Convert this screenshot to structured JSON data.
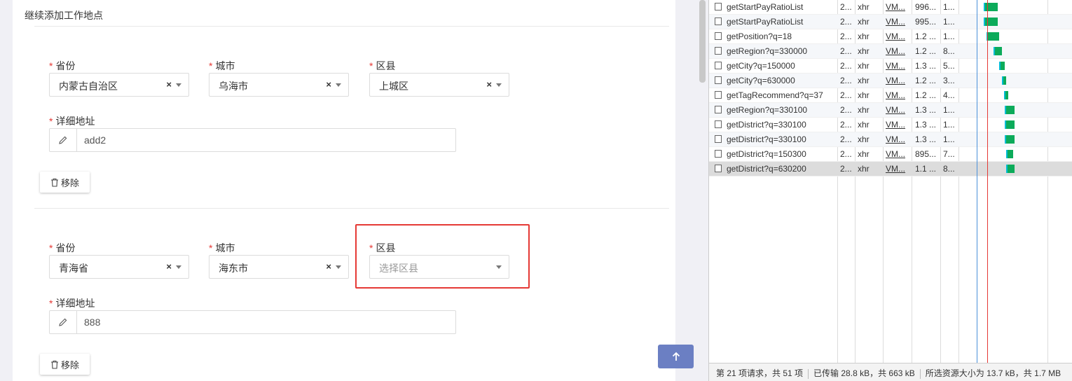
{
  "form": {
    "section_title": "继续添加工作地点",
    "entries": [
      {
        "province_label": "省份",
        "province_value": "内蒙古自治区",
        "city_label": "城市",
        "city_value": "乌海市",
        "district_label": "区县",
        "district_value": "上城区",
        "address_label": "详细地址",
        "address_value": "add2",
        "remove_label": "移除"
      },
      {
        "province_label": "省份",
        "province_value": "青海省",
        "city_label": "城市",
        "city_value": "海东市",
        "district_label": "区县",
        "district_placeholder": "选择区县",
        "address_label": "详细地址",
        "address_value": "888",
        "remove_label": "移除"
      }
    ],
    "required_mark": "*",
    "clear_mark": "×"
  },
  "network": {
    "rows": [
      {
        "name": "getStartPayRatioList",
        "status": "2...",
        "type": "xhr",
        "initiator": "VM...",
        "size": "996...",
        "time": "1..."
      },
      {
        "name": "getStartPayRatioList",
        "status": "2...",
        "type": "xhr",
        "initiator": "VM...",
        "size": "995...",
        "time": "1..."
      },
      {
        "name": "getPosition?q=18",
        "status": "2...",
        "type": "xhr",
        "initiator": "VM...",
        "size": "1.2 ...",
        "time": "1..."
      },
      {
        "name": "getRegion?q=330000",
        "status": "2...",
        "type": "xhr",
        "initiator": "VM...",
        "size": "1.2 ...",
        "time": "8..."
      },
      {
        "name": "getCity?q=150000",
        "status": "2...",
        "type": "xhr",
        "initiator": "VM...",
        "size": "1.3 ...",
        "time": "5..."
      },
      {
        "name": "getCity?q=630000",
        "status": "2...",
        "type": "xhr",
        "initiator": "VM...",
        "size": "1.2 ...",
        "time": "3..."
      },
      {
        "name": "getTagRecommend?q=37",
        "status": "2...",
        "type": "xhr",
        "initiator": "VM...",
        "size": "1.2 ...",
        "time": "4..."
      },
      {
        "name": "getRegion?q=330100",
        "status": "2...",
        "type": "xhr",
        "initiator": "VM...",
        "size": "1.3 ...",
        "time": "1..."
      },
      {
        "name": "getDistrict?q=330100",
        "status": "2...",
        "type": "xhr",
        "initiator": "VM...",
        "size": "1.3 ...",
        "time": "1..."
      },
      {
        "name": "getDistrict?q=330100",
        "status": "2...",
        "type": "xhr",
        "initiator": "VM...",
        "size": "1.3 ...",
        "time": "1..."
      },
      {
        "name": "getDistrict?q=150300",
        "status": "2...",
        "type": "xhr",
        "initiator": "VM...",
        "size": "895...",
        "time": "7..."
      },
      {
        "name": "getDistrict?q=630200",
        "status": "2...",
        "type": "xhr",
        "initiator": "VM...",
        "size": "1.1 ...",
        "time": "8..."
      }
    ],
    "status_requests": "第 21 项请求，共 51 项",
    "status_transferred": "已传输 28.8 kB，共 663 kB",
    "status_resources": "所选资源大小为 13.7 kB，共 1.7 MB"
  },
  "colors": {
    "required": "#e53935",
    "highlight": "#e53935",
    "up_button": "#6b7fc3",
    "waterfall_bar": "#0cab5a",
    "dom_line": "#4a90d9",
    "load_line": "#e53935"
  },
  "icons": [
    "pencil-icon",
    "trash-icon",
    "arrow-up-icon",
    "caret-down-icon"
  ]
}
